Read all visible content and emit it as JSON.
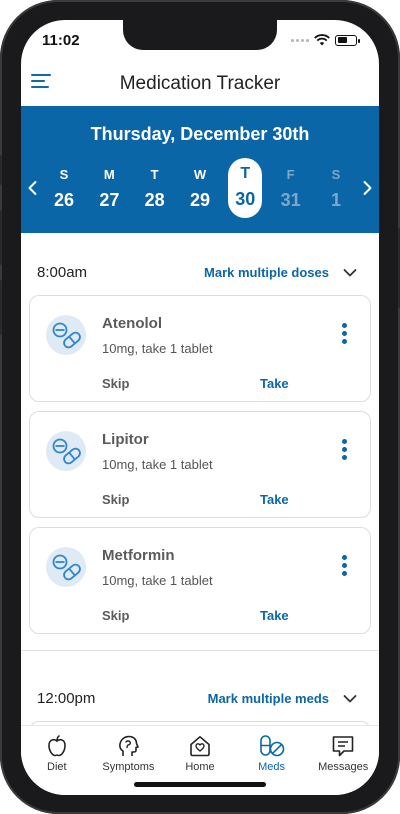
{
  "status_bar": {
    "time": "11:02"
  },
  "header": {
    "title": "Medication Tracker"
  },
  "date_band": {
    "date_title": "Thursday, December 30th",
    "days": [
      {
        "letter": "S",
        "number": "26",
        "state": "normal"
      },
      {
        "letter": "M",
        "number": "27",
        "state": "normal"
      },
      {
        "letter": "T",
        "number": "28",
        "state": "normal"
      },
      {
        "letter": "W",
        "number": "29",
        "state": "normal"
      },
      {
        "letter": "T",
        "number": "30",
        "state": "selected"
      },
      {
        "letter": "F",
        "number": "31",
        "state": "faded"
      },
      {
        "letter": "S",
        "number": "1",
        "state": "faded"
      }
    ]
  },
  "groups": [
    {
      "time": "8:00am",
      "mark_label": "Mark multiple doses",
      "meds": [
        {
          "name": "Atenolol",
          "dose": "10mg, take 1 tablet",
          "skip": "Skip",
          "take": "Take"
        },
        {
          "name": "Lipitor",
          "dose": "10mg, take 1 tablet",
          "skip": "Skip",
          "take": "Take"
        },
        {
          "name": "Metformin",
          "dose": "10mg, take 1 tablet",
          "skip": "Skip",
          "take": "Take"
        }
      ]
    },
    {
      "time": "12:00pm",
      "mark_label": "Mark multiple meds",
      "meds": []
    }
  ],
  "bottom_nav": [
    {
      "label": "Diet",
      "icon": "apple-icon",
      "active": false
    },
    {
      "label": "Symptoms",
      "icon": "head-icon",
      "active": false
    },
    {
      "label": "Home",
      "icon": "home-heart-icon",
      "active": false
    },
    {
      "label": "Meds",
      "icon": "pills-icon",
      "active": true
    },
    {
      "label": "Messages",
      "icon": "message-icon",
      "active": false
    }
  ],
  "colors": {
    "primary": "#0b66a8",
    "pill_bg": "#dfeaf5",
    "faded_day": "#7ba8cc"
  }
}
